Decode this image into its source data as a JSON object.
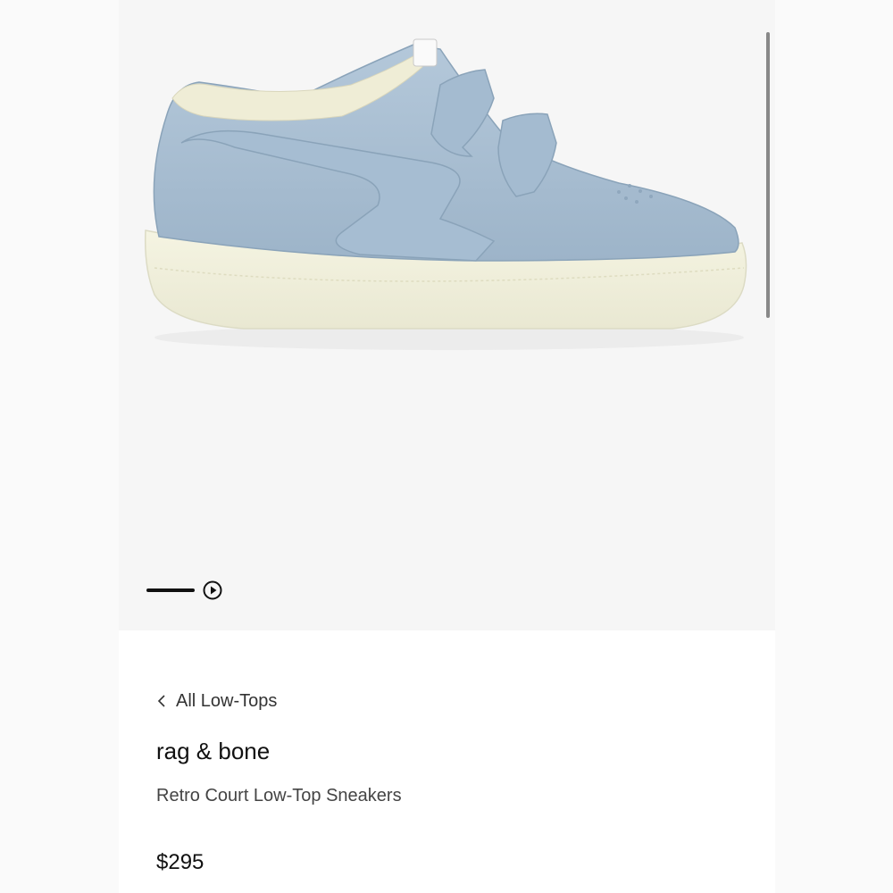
{
  "breadcrumb": {
    "label": "All Low-Tops"
  },
  "product": {
    "brand": "rag & bone",
    "name": "Retro Court Low-Top Sneakers",
    "price": "$295"
  },
  "gallery": {
    "image_subject": "light blue leather low-top sneaker with double hook-and-loop straps",
    "current_slide": 1,
    "slide_count": 1,
    "controls": {
      "indicator": "progress-line",
      "play_icon": "play-circle-icon"
    }
  },
  "colors": {
    "shoe_leather": "#a9bfd3",
    "sole": "#f1f0dc",
    "text_primary": "#111111"
  }
}
